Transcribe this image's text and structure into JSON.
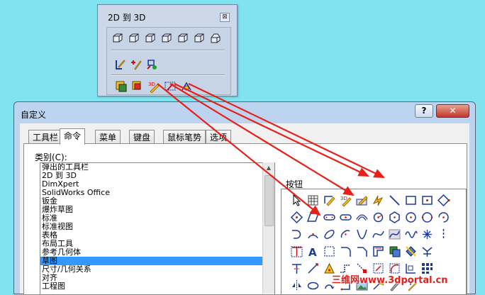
{
  "toolbar": {
    "title": "2D 到 3D",
    "close_symbol": "⊠"
  },
  "dialog": {
    "title": "自定义",
    "help_symbol": "?",
    "close_symbol": "✕",
    "tabs": [
      {
        "label": "工具栏"
      },
      {
        "label": "命令"
      },
      {
        "label": "菜单"
      },
      {
        "label": "键盘"
      },
      {
        "label": "鼠标笔势"
      },
      {
        "label": "选项"
      }
    ],
    "category_label": "类别(C):",
    "categories": [
      "弹出的工具栏",
      "2D 到 3D",
      "DimXpert",
      "SolidWorks Office",
      "钣金",
      "爆炸草图",
      "标准",
      "标准视图",
      "表格",
      "布局工具",
      "参考几何体",
      "草图",
      "尺寸/几何关系",
      "对齐",
      "工程图"
    ],
    "selected_category": "草图",
    "buttons_label": "按钮"
  },
  "watermark": "三维网www.3dportal.cn",
  "colors": {
    "desktop": "#7fe3f0",
    "arrow": "#e8201a",
    "selection": "#3399ff"
  }
}
